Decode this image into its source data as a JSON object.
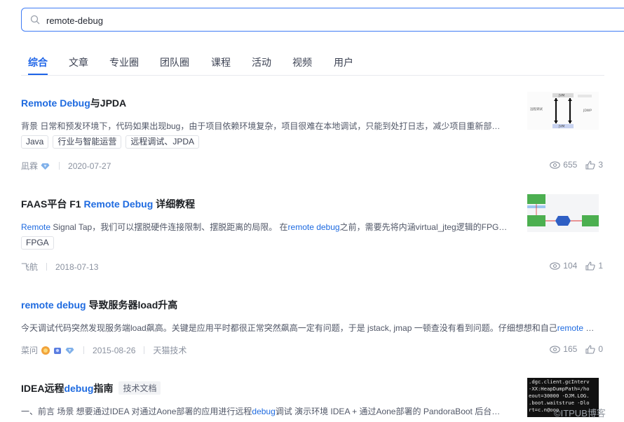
{
  "search": {
    "value": "remote-debug"
  },
  "tabs": [
    "综合",
    "文章",
    "专业圈",
    "团队圈",
    "课程",
    "活动",
    "视频",
    "用户"
  ],
  "results": [
    {
      "title_parts": [
        "Remote Debug",
        "与JPDA"
      ],
      "desc": "背景 日常和预发环境下，代码如果出现bug，由于项目依赖环境复杂，项目很难在本地调试，只能到处打日志，减少项目重新部…",
      "tags": [
        "Java",
        "行业与智能运营",
        "远程调试、JPDA"
      ],
      "author": "凪霖",
      "date": "2020-07-27",
      "views": "655",
      "likes": "3"
    },
    {
      "title_parts": [
        "FAAS平台 F1 ",
        "Remote Debug",
        " 详细教程"
      ],
      "desc_parts": [
        "Remote",
        " Signal Tap，我们可以摆脱硬件连接限制、摆脱距离的局限。 在",
        "remote debug",
        "之前，需要先将内涵virtual_jteg逻辑的FPG…"
      ],
      "tags": [
        "FPGA"
      ],
      "author": "飞航",
      "date": "2018-07-13",
      "views": "104",
      "likes": "1"
    },
    {
      "title_parts": [
        "remote debug",
        " 导致服务器load升高"
      ],
      "desc_parts": [
        "今天调试代码突然发现服务端load飙高。关键是应用平时都很正常突然飙高一定有问题，于是 jstack, jmap 一顿查没有看到问题。仔细想想和自己",
        "remote",
        " …"
      ],
      "author": "菜问",
      "date": "2015-08-26",
      "team": "天猫技术",
      "views": "165",
      "likes": "0"
    },
    {
      "title_parts": [
        "IDEA远程",
        "debug",
        "指南"
      ],
      "badge": "技术文档",
      "desc_parts": [
        "一、前言 场景 想要通过IDEA 对通过Aone部署的应用进行远程",
        "debug",
        "调试 演示环境 IDEA + 通过Aone部署的 PandoraBoot 后台…"
      ]
    }
  ],
  "thumb_texts": {
    "t1": [
      "远程调试",
      "JDWP",
      "JVM",
      "JVM"
    ],
    "t4": [
      ".dgc.client.gcInterv",
      "-XX:HeapDumpPath=/ho",
      "eout=30000 -DJM.LOG.",
      ".boot.waitstrue -Dlo",
      "rt=c.n@ooo"
    ]
  },
  "watermark": "©ITPUB博客",
  "colors": {
    "accent": "#1d64e8",
    "highlight": "#1f6be0",
    "muted": "#8a919f"
  }
}
